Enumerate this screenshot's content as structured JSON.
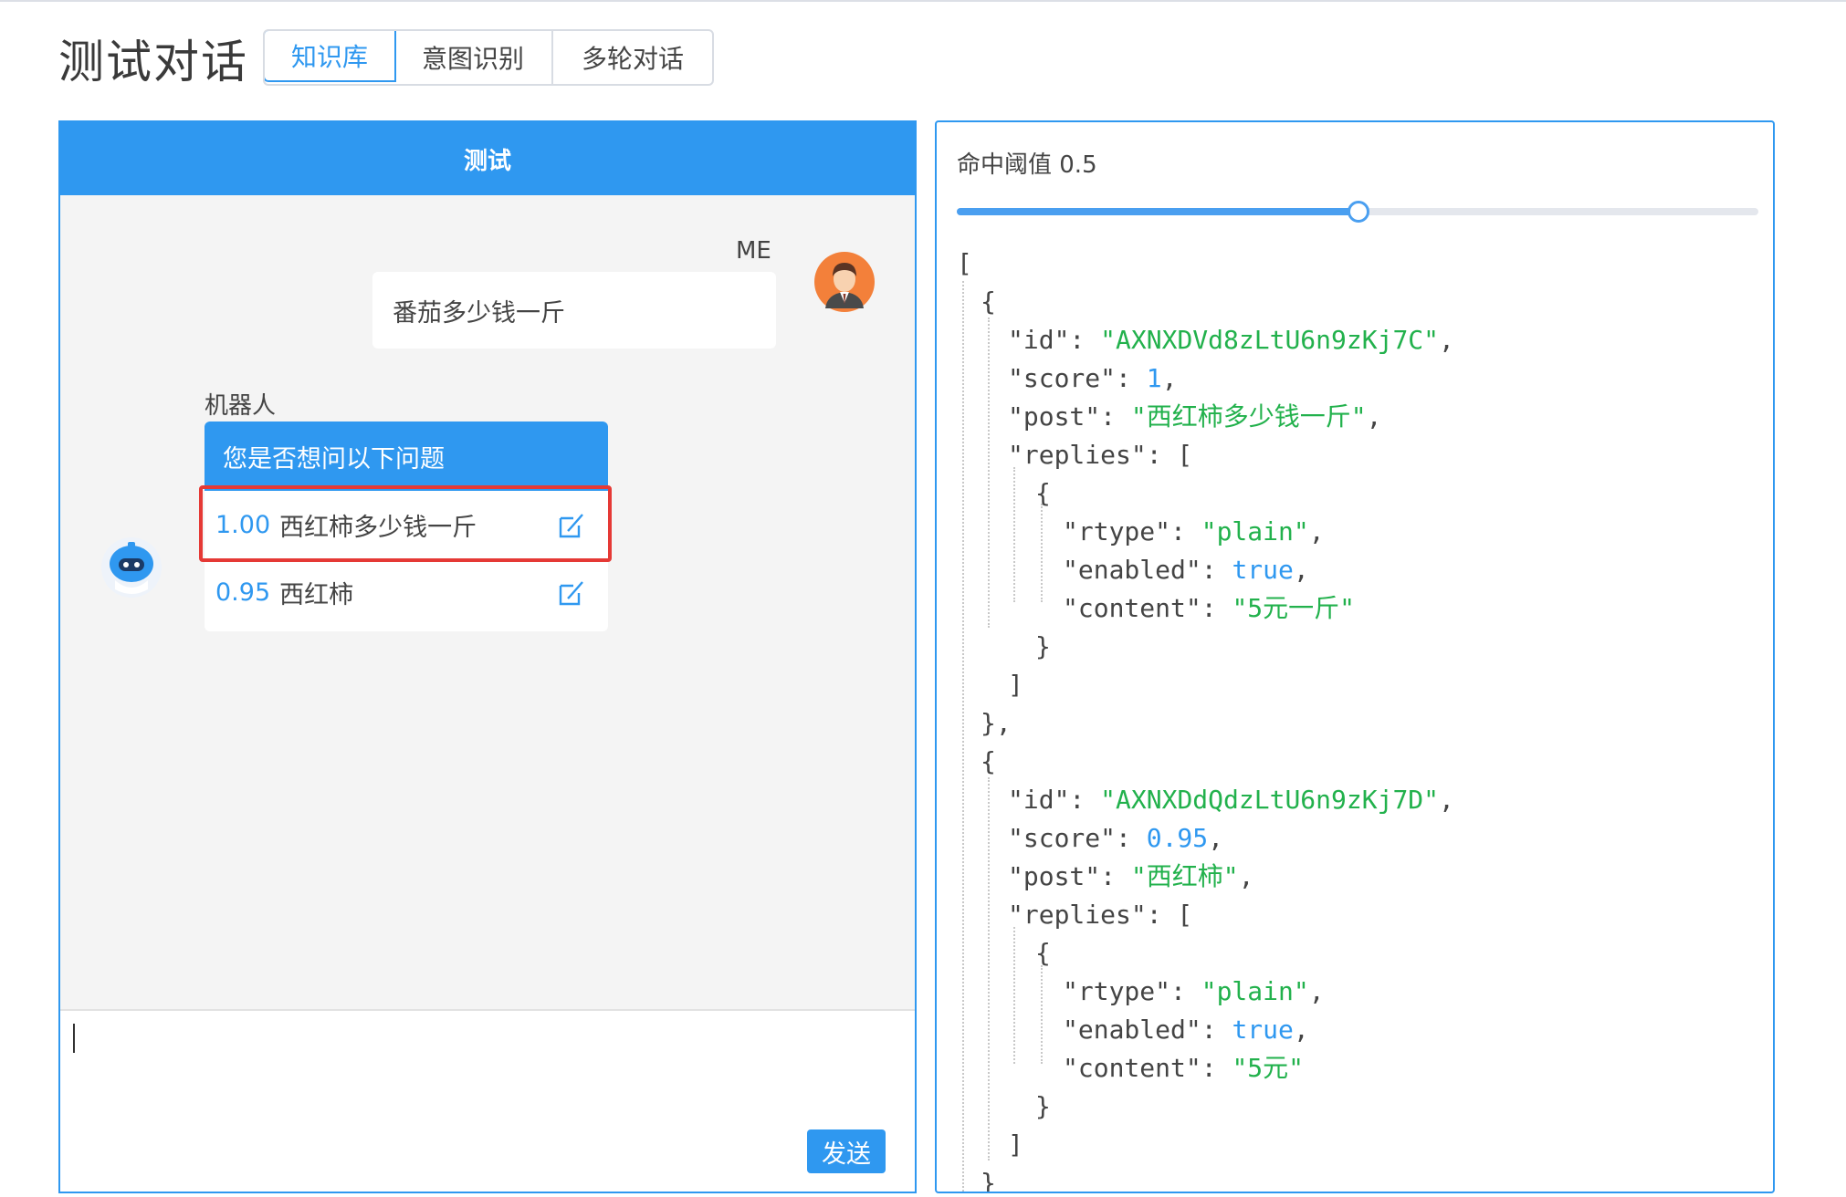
{
  "page": {
    "title": "测试对话",
    "tabs": [
      {
        "label": "知识库",
        "active": true
      },
      {
        "label": "意图识别",
        "active": false
      },
      {
        "label": "多轮对话",
        "active": false
      }
    ]
  },
  "chat": {
    "header": "测试",
    "me_name": "ME",
    "me_message": "番茄多少钱一斤",
    "bot_name": "机器人",
    "bot_prompt": "您是否想问以下问题",
    "suggestions": [
      {
        "score": "1.00",
        "text": "西红柿多少钱一斤",
        "highlighted": true
      },
      {
        "score": "0.95",
        "text": "西红柿",
        "highlighted": false
      }
    ],
    "input_value": "",
    "send_label": "发送"
  },
  "threshold": {
    "label": "命中阈值 0.5",
    "value": 0.5
  },
  "json_tokens": {
    "open_arr": "[",
    "open_obj": "{",
    "close_obj": "}",
    "close_obj_comma": "},",
    "close_arr": "]",
    "k_id": "\"id\": ",
    "k_score": "\"score\": ",
    "k_post": "\"post\": ",
    "k_replies": "\"replies\": [",
    "k_rtype": "\"rtype\": ",
    "k_enabled": "\"enabled\": ",
    "k_content": "\"content\": ",
    "comma": ",",
    "r1_id": "\"AXNXDVd8zLtU6n9zKj7C\"",
    "r1_score": "1",
    "r1_post": "\"西红柿多少钱一斤\"",
    "r1_rtype": "\"plain\"",
    "r1_enabled": "true",
    "r1_content": "\"5元一斤\"",
    "r2_id": "\"AXNXDdQdzLtU6n9zKj7D\"",
    "r2_score": "0.95",
    "r2_post": "\"西红柿\"",
    "r2_rtype": "\"plain\"",
    "r2_enabled": "true",
    "r2_content": "\"5元\""
  },
  "colors": {
    "primary": "#2f98f0",
    "string": "#22b14c",
    "highlight": "#e53935"
  }
}
